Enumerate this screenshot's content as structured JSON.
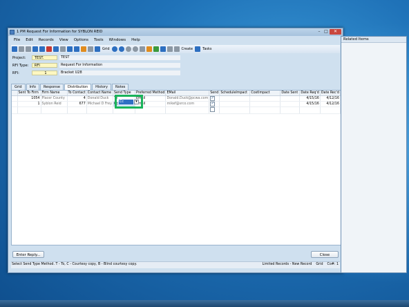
{
  "window": {
    "title": "1 PM Request For Information for SYBLON REID",
    "buttons": {
      "minimize": "–",
      "maximize": "□",
      "close": "✕"
    }
  },
  "menu": [
    "File",
    "Edit",
    "Records",
    "View",
    "Options",
    "Tools",
    "Windows",
    "Help"
  ],
  "toolbar": {
    "grid_label": "Grid",
    "create_label": "Create",
    "tasks_label": "Tasks"
  },
  "form": {
    "project_label": "Project:",
    "project_code": "TEST.",
    "project_value": "TEST",
    "rfi_type_label": "RFI Type:",
    "rfi_type_code": "RFI",
    "rfi_type_value": "Request For Information",
    "rfi_label": "RFI:",
    "rfi_code": "1",
    "rfi_value": "Bracket U28"
  },
  "tabs": [
    "Grid",
    "Info",
    "Response",
    "Distribution",
    "History",
    "Notes"
  ],
  "active_tab": "Distribution",
  "grid": {
    "headers": [
      "Sent To Firm",
      "Firm Name",
      "To Contact",
      "Contact Name",
      "Send Type",
      "Preferred Method",
      "EMail",
      "Send",
      "ScheduleImpact",
      "CostImpact",
      "Date Sent",
      "Date Req'd",
      "Date Rec'd"
    ],
    "rows": [
      {
        "firm": "1054",
        "firm_name": "Placer County",
        "contact": "4",
        "contact_name": "Donald Duck",
        "send_type": "To",
        "method": "Email",
        "email": "Donald.Duck@pcwa.com",
        "send": "✓",
        "schedule": "",
        "cost": "",
        "date_sent": "",
        "date_reqd": "4/15/16",
        "date_recd": "4/12/16"
      },
      {
        "firm": "1",
        "firm_name": "Syblon Reid",
        "contact": "677",
        "contact_name": "Michael D Frey",
        "send_type": "Cc",
        "method": "Email",
        "email": "mikef@srco.com",
        "send": "✓",
        "schedule": "",
        "cost": "",
        "date_sent": "",
        "date_reqd": "4/15/16",
        "date_recd": "4/12/16"
      }
    ],
    "editing_value": "Cc"
  },
  "buttons": {
    "enter_reply": "Enter Reply...",
    "close": "Close"
  },
  "status": {
    "message": "Select Send Type Method. T - To, C - Courtesy copy, B - Blind courtesy copy.",
    "limited": "Limited Records - New Record",
    "grid": "Grid",
    "col": "Co#: 1"
  },
  "related": {
    "title": "Related Items"
  }
}
